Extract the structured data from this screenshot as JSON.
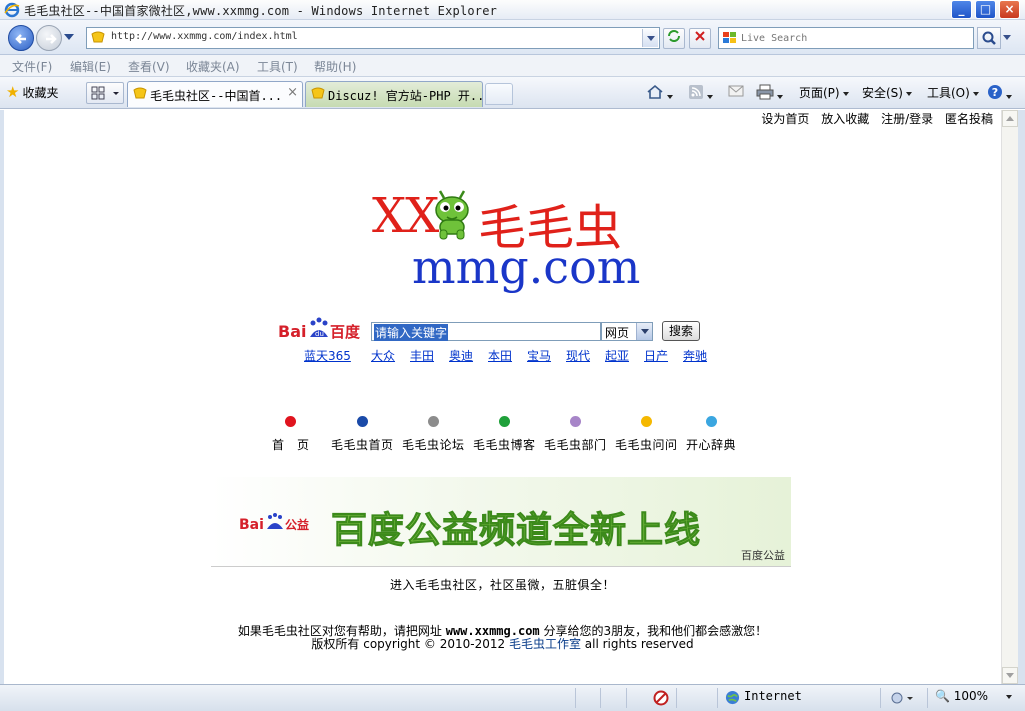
{
  "window": {
    "title": "毛毛虫社区--中国首家微社区,www.xxmmg.com - Windows Internet Explorer",
    "minimize": "_",
    "maximize": "□",
    "close": "×"
  },
  "address": {
    "url": "http://www.xxmmg.com/index.html",
    "search_placeholder": "Live Search"
  },
  "menu": [
    "文件(F)",
    "编辑(E)",
    "查看(V)",
    "收藏夹(A)",
    "工具(T)",
    "帮助(H)"
  ],
  "favorites_label": "收藏夹",
  "tabs": [
    {
      "label": "毛毛虫社区--中国首...",
      "close": "×"
    },
    {
      "label": "Discuz! 官方站-PHP 开..."
    }
  ],
  "commands": {
    "page": "页面(P)",
    "safety": "安全(S)",
    "tools": "工具(O)"
  },
  "top_links": [
    "设为首页",
    "放入收藏",
    "注册/登录",
    "匿名投稿"
  ],
  "logo": {
    "prefix": "XX",
    "name": "毛毛虫",
    "domain": "mmg.com"
  },
  "search": {
    "baidu_text": "Bai百度",
    "query": "请输入关键字",
    "type": "网页",
    "button": "搜索",
    "brands": [
      "蓝天365",
      "大众",
      "丰田",
      "奥迪",
      "本田",
      "宝马",
      "现代",
      "起亚",
      "日产",
      "奔驰"
    ]
  },
  "nav": [
    {
      "label": "首　页",
      "color": "#e0141e"
    },
    {
      "label": "毛毛虫首页",
      "color": "#1a4aa8"
    },
    {
      "label": "毛毛虫论坛",
      "color": "#8c8c8c"
    },
    {
      "label": "毛毛虫博客",
      "color": "#1fa03a"
    },
    {
      "label": "毛毛虫部门",
      "color": "#a785c8"
    },
    {
      "label": "毛毛虫问问",
      "color": "#f5b800"
    },
    {
      "label": "开心辞典",
      "color": "#3aa6e0"
    }
  ],
  "banner": {
    "logo": "Bai公益",
    "headline": "百度公益频道全新上线",
    "small": "百度公益"
  },
  "tagline": "进入毛毛虫社区，社区虽微，五脏俱全！",
  "footer": {
    "line1_a": "如果毛毛虫社区对您有帮助，请把网址 ",
    "line1_site": "www.xxmmg.com",
    "line1_b": " 分享给您的3朋友，我和他们都会感激您！",
    "line2_a": "版权所有 copyright ©  2010-2012  ",
    "line2_studio": "毛毛虫工作室",
    "line2_b": " all rights reserved"
  },
  "status": {
    "zone": "Internet",
    "zoom": "100%"
  }
}
